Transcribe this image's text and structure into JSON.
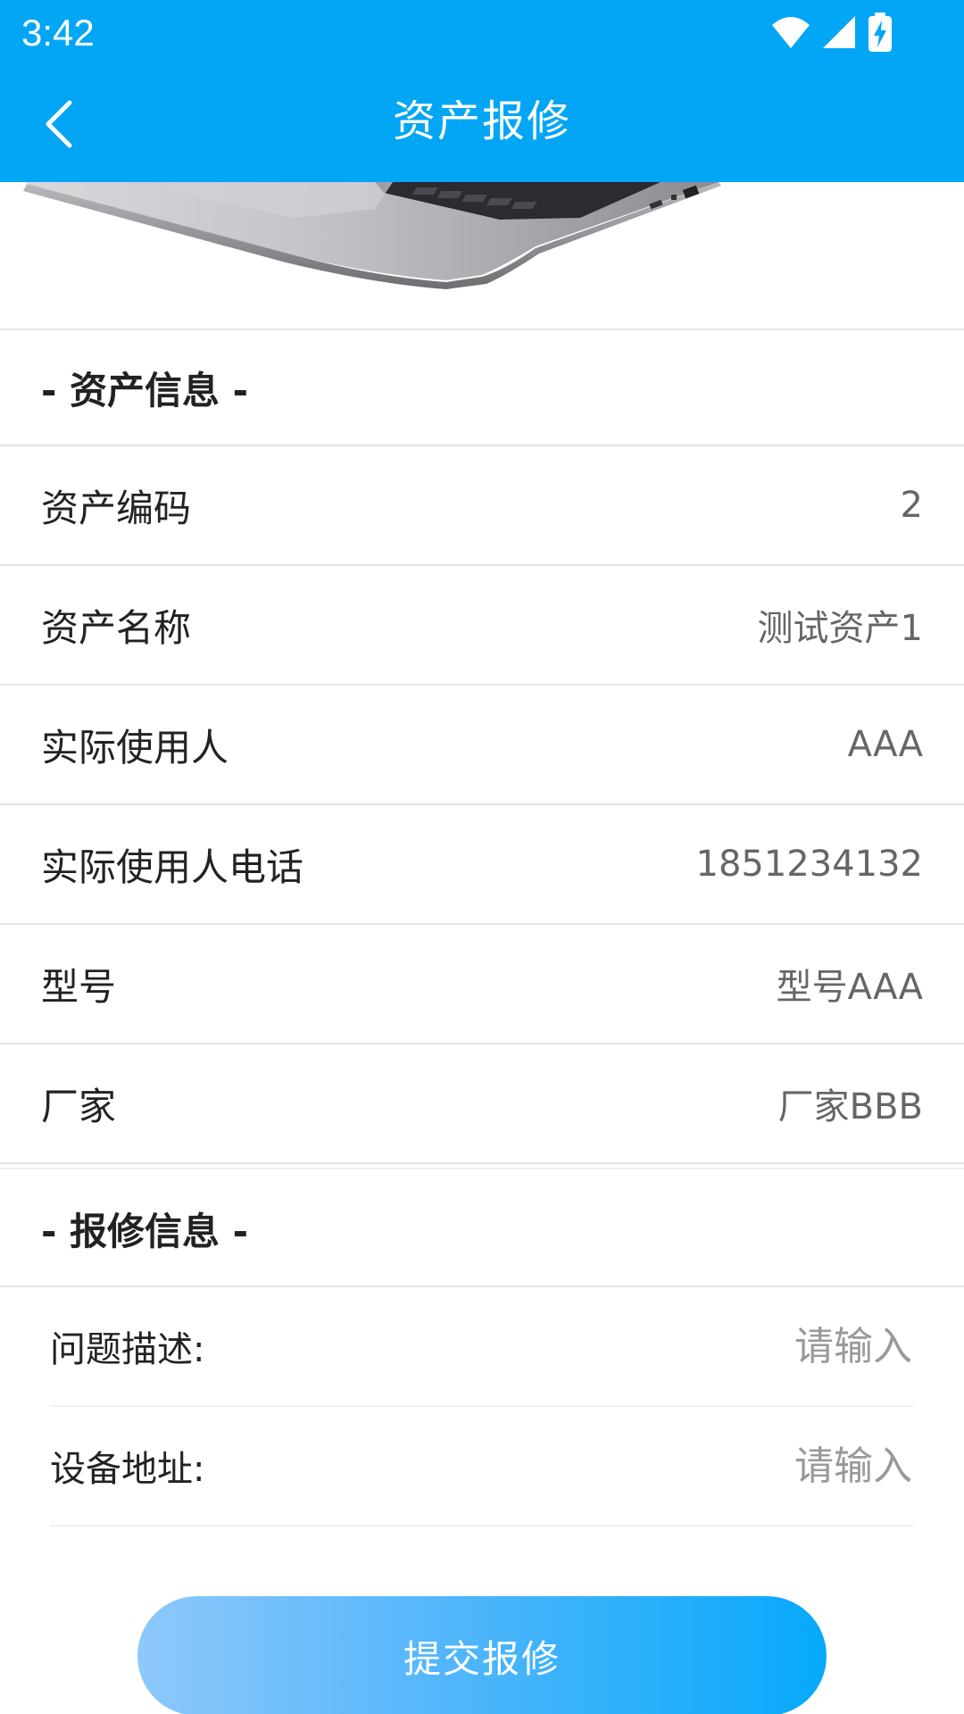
{
  "status_bar": {
    "time": "3:42"
  },
  "header": {
    "title": "资产报修"
  },
  "asset_section": {
    "heading": "- 资产信息 -",
    "rows": [
      {
        "label": "资产编码",
        "value": "2"
      },
      {
        "label": "资产名称",
        "value": "测试资产1"
      },
      {
        "label": "实际使用人",
        "value": "AAA"
      },
      {
        "label": "实际使用人电话",
        "value": "1851234132"
      },
      {
        "label": "型号",
        "value": "型号AAA"
      },
      {
        "label": "厂家",
        "value": "厂家BBB"
      }
    ]
  },
  "repair_section": {
    "heading": "- 报修信息 -",
    "fields": [
      {
        "label": "问题描述:",
        "placeholder": "请输入"
      },
      {
        "label": "设备地址:",
        "placeholder": "请输入"
      }
    ]
  },
  "submit": {
    "label": "提交报修"
  },
  "colors": {
    "brand": "#03A6F5",
    "button_gradient_start": "#8ec8fb",
    "button_gradient_end": "#06a9fb"
  }
}
